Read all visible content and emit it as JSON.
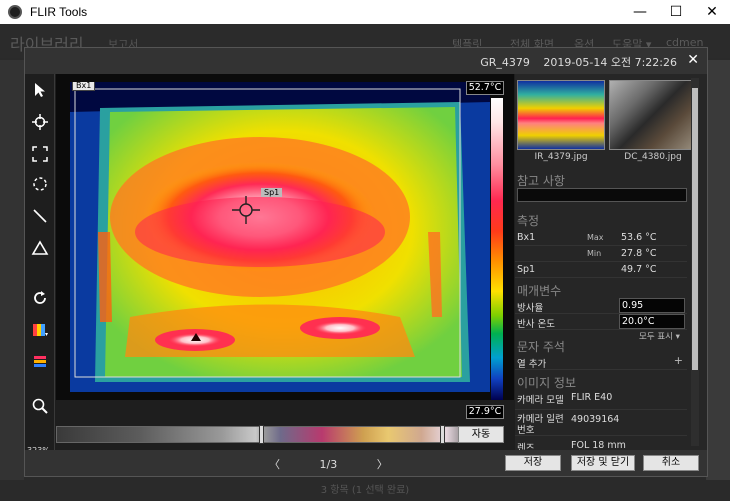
{
  "window": {
    "title": "FLIR Tools",
    "minimize": "—",
    "maximize": "☐",
    "close": "✕"
  },
  "background": {
    "library_title": "라이브러리",
    "report": "보고서",
    "menu": [
      "템플릿",
      "전체 화면",
      "옵션",
      "도움말 ▾",
      "cdmen"
    ],
    "status": "3 항목 (1 선택 완료)"
  },
  "dialog": {
    "filename": "GR_4379",
    "datetime": "2019-05-14 오전 7:22:26",
    "close": "✕"
  },
  "tools": {
    "zoom": "323%",
    "items": [
      "select-arrow-icon",
      "spot-tool-icon",
      "box-tool-icon",
      "ellipse-tool-icon",
      "line-tool-icon",
      "delta-tool-icon",
      "rotate-icon",
      "palette-icon",
      "color-scale-icon",
      "zoom-icon"
    ]
  },
  "image": {
    "temp_max": "52.7°C",
    "temp_min": "27.9°C",
    "box_label": "Bx1",
    "spot_label": "Sp1",
    "palette_button": "자동",
    "scale_colors": [
      "#ffffff",
      "#ff2850",
      "#ff9000",
      "#ffe000",
      "#00b050",
      "#1040c0",
      "#000050"
    ]
  },
  "thumbnails": [
    {
      "caption": "IR_4379.jpg"
    },
    {
      "caption": "DC_4380.jpg"
    }
  ],
  "panel": {
    "notes_title": "참고 사항",
    "measure_title": "측정",
    "measurements": [
      {
        "name": "Bx1",
        "sub": "Max",
        "value": "53.6 °C"
      },
      {
        "name": "",
        "sub": "Min",
        "value": "27.8 °C"
      },
      {
        "name": "Sp1",
        "sub": "",
        "value": "49.7 °C"
      }
    ],
    "params_title": "매개변수",
    "params": [
      {
        "name": "방사율",
        "value": "0.95"
      },
      {
        "name": "반사 온도",
        "value": "20.0°C"
      }
    ],
    "show_all": "모두 표시 ▾",
    "text_title": "문자 주석",
    "add_row": "열 추가",
    "add_icon": "+",
    "image_info_title": "이미지 정보",
    "info": [
      {
        "name": "카메라 모델",
        "value": "FLIR E40"
      },
      {
        "name": "카메라 일련 번호",
        "value": "49039164"
      },
      {
        "name": "렌즈",
        "value": "FOL 18 mm"
      }
    ]
  },
  "footer": {
    "prev": "〈",
    "page": "1/3",
    "next": "〉",
    "save": "저장",
    "save_close": "저장 및 닫기",
    "cancel": "취소"
  }
}
